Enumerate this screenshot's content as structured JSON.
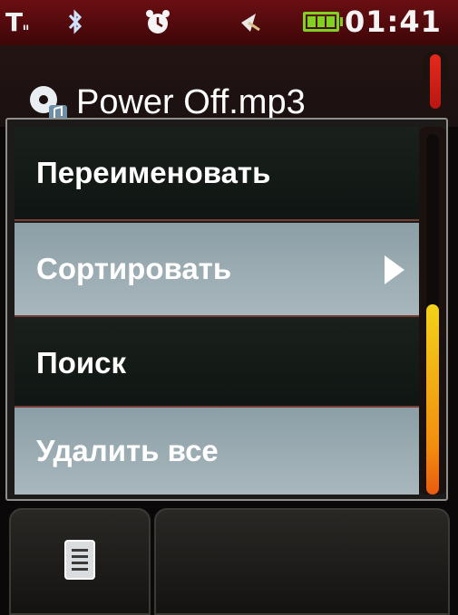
{
  "status_bar": {
    "signal_text": "T",
    "signal_sub": "ıı",
    "bluetooth_icon": "bluetooth-icon",
    "alarm_icon": "alarm-clock-icon",
    "network_icon": "network-arrow-icon",
    "battery_level": 1.0,
    "time": "01:41"
  },
  "title": {
    "icon": "disc-file-icon",
    "text": "Power Off.mp3"
  },
  "menu": {
    "items": [
      {
        "label": "Переименовать",
        "highlighted": false,
        "has_submenu": false
      },
      {
        "label": "Сортировать",
        "highlighted": true,
        "has_submenu": true
      },
      {
        "label": "Поиск",
        "highlighted": false,
        "has_submenu": false
      },
      {
        "label": "Удалить все",
        "highlighted": true,
        "has_submenu": false
      }
    ]
  },
  "softkeys": {
    "left_icon": "menu-list-icon",
    "right_label": ""
  },
  "colors": {
    "status_bar": "#5a0b0e",
    "highlight": "#9aaeb4",
    "scroll_thumb": "#f2b414",
    "battery": "#7ed321"
  }
}
